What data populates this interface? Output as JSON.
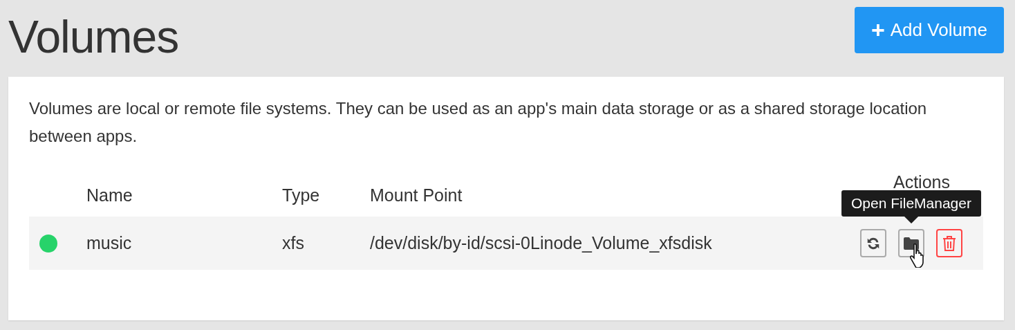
{
  "page": {
    "title": "Volumes",
    "add_button": {
      "icon": "+",
      "label": "Add Volume"
    }
  },
  "description": "Volumes are local or remote file systems. They can be used as an app's main data storage or as a shared storage location between apps.",
  "table": {
    "columns": [
      "Name",
      "Type",
      "Mount Point",
      "Actions"
    ],
    "rows": [
      {
        "color": "#27d36a",
        "name": "music",
        "type": "xfs",
        "mount_point": "/dev/disk/by-id/scsi-0Linode_Volume_xfsdisk",
        "actions": [
          {
            "kind": "remount",
            "tooltip_shown": false
          },
          {
            "kind": "files",
            "tooltip_shown": true,
            "tooltip": "Open FileManager"
          },
          {
            "kind": "delete",
            "tooltip_shown": false
          }
        ]
      }
    ]
  }
}
